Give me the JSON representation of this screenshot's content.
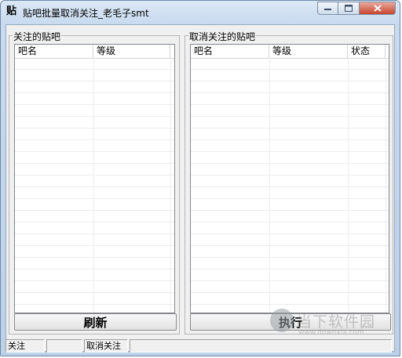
{
  "window": {
    "title": "贴吧批量取消关注_老毛子smt",
    "icon_char": "贴"
  },
  "left_panel": {
    "label": "关注的贴吧",
    "columns": [
      "吧名",
      "等级"
    ],
    "button_label": "刷新"
  },
  "right_panel": {
    "label": "取消关注的贴吧",
    "columns": [
      "吧名",
      "等级",
      "状态"
    ],
    "button_label": "执行"
  },
  "statusbar": {
    "panes": [
      "关注",
      "",
      "取消关注",
      ""
    ]
  },
  "watermark": {
    "brand": "当下软件园",
    "url": "www.downxia.com"
  },
  "colors": {
    "accent_close": "#c7452f",
    "titlebar": "#c8daef",
    "client": "#f0f0f0"
  }
}
